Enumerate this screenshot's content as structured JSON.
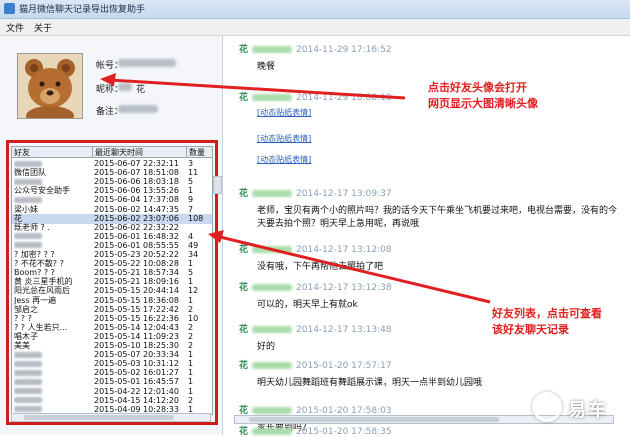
{
  "window": {
    "title": "猫月微信聊天记录导出恢复助手"
  },
  "menu": [
    {
      "label": "文件"
    },
    {
      "label": "关于"
    }
  ],
  "profile": {
    "account_label": "帐号：",
    "nickname_label": "昵称：",
    "nickname_value": "花",
    "remark_label": "备注："
  },
  "friends_table": {
    "columns": [
      "好友",
      "最近聊天时间",
      "数量"
    ],
    "rows": [
      {
        "name": "",
        "time": "2015-06-07 22:32:11",
        "count": "3"
      },
      {
        "name": "微信团队",
        "time": "2015-06-07 18:51:08",
        "count": "11"
      },
      {
        "name": "",
        "time": "2015-06-06 18:03:18",
        "count": "5"
      },
      {
        "name": "公众号安全助手",
        "time": "2015-06-06 13:55:26",
        "count": "1"
      },
      {
        "name": "",
        "time": "2015-06-04 17:37:08",
        "count": "9"
      },
      {
        "name": "梁小妹",
        "time": "2015-06-02 14:47:35",
        "count": "7"
      },
      {
        "name": "花",
        "time": "2015-06-02 23:07:06",
        "count": "108"
      },
      {
        "name": "既老师 ? . ",
        "time": "2015-06-02 22:32:22",
        "count": ""
      },
      {
        "name": "",
        "time": "2015-06-01 16:48:32",
        "count": "4"
      },
      {
        "name": "",
        "time": "2015-06-01 08:55:55",
        "count": "49"
      },
      {
        "name": "? 加密? ? ?",
        "time": "2015-05-23 20:52:22",
        "count": "34"
      },
      {
        "name": "? 不花不散? ?",
        "time": "2015-05-22 10:08:28",
        "count": "1"
      },
      {
        "name": "Boom? ? ?",
        "time": "2015-05-21 18:57:34",
        "count": "5"
      },
      {
        "name": "黄 炎三星手机的",
        "time": "2015-05-21 18:09:16",
        "count": "1"
      },
      {
        "name": "阳光总在风雨后",
        "time": "2015-05-15 20:44:14",
        "count": "12"
      },
      {
        "name": "Jess 再一遍",
        "time": "2015-05-15 18:36:08",
        "count": "1"
      },
      {
        "name": "邹启之",
        "time": "2015-05-15 17:22:42",
        "count": "2"
      },
      {
        "name": "? ? ?",
        "time": "2015-05-15 16:22:36",
        "count": "10"
      },
      {
        "name": "? ? 人生若只...",
        "time": "2015-05-14 12:04:43",
        "count": "2"
      },
      {
        "name": "唱木子",
        "time": "2015-05-14 11:09:23",
        "count": "2"
      },
      {
        "name": "美美",
        "time": "2015-05-10 18:25:30",
        "count": "2"
      },
      {
        "name": "",
        "time": "2015-05-07 20:33:34",
        "count": "1"
      },
      {
        "name": "",
        "time": "2015-05-03 10:31:12",
        "count": "1"
      },
      {
        "name": "",
        "time": "2015-05-02 16:01:27",
        "count": "1"
      },
      {
        "name": "",
        "time": "2015-05-01 16:45:57",
        "count": "1"
      },
      {
        "name": "",
        "time": "2015-04-22 12:01:40",
        "count": "1"
      },
      {
        "name": "",
        "time": "2015-04-15 14:12:20",
        "count": "2"
      },
      {
        "name": "",
        "time": "2015-04-09 10:28:33",
        "count": "1"
      }
    ]
  },
  "chat": [
    {
      "sender": "花",
      "timestamp": "2014-11-29 17:16:52",
      "text": "晚餐"
    },
    {
      "sender": "花",
      "timestamp": "2014-11-29 18:08:18",
      "link": "[动态贴纸表情]"
    },
    {
      "sender": "",
      "timestamp": "",
      "link": "[动态贴纸表情]"
    },
    {
      "sender": "",
      "timestamp": "",
      "link": "[动态贴纸表情]"
    },
    {
      "sender": "花",
      "timestamp": "2014-12-17 13:09:37",
      "text": "老师，宝贝有两个小的照片吗？我的话今天下午乘坐飞机要过来吧，电视台需要，没有的今",
      "text2": "天要去拍个照？明天早上急用呢，再说哦"
    },
    {
      "sender": "花",
      "timestamp": "2014-12-17 13:12:08",
      "text": "没有哦，下午再帮他去照拍了吧"
    },
    {
      "sender": "花",
      "timestamp": "2014-12-17 13:12:38",
      "text": "可以的，明天早上有就ok"
    },
    {
      "sender": "花",
      "timestamp": "2014-12-17 13:13:48",
      "text": "好的"
    },
    {
      "sender": "花",
      "timestamp": "2015-01-20 17:57:17",
      "text": "明天幼儿园舞蹈班有舞蹈展示课，明天一点半到幼儿园哦"
    },
    {
      "sender": "花",
      "timestamp": "2015-01-20 17:58:03",
      "text": "家长要到吗？"
    },
    {
      "sender": "花",
      "timestamp": "2015-01-20 17:58:35",
      "text": ""
    }
  ],
  "annotations": {
    "avatar_note_line1": "点击好友头像会打开",
    "avatar_note_line2": "网页显示大图清晰头像",
    "list_note_line1": "好友列表，点击可查看",
    "list_note_line2": "该好友聊天记录"
  },
  "watermark": {
    "text": "易车"
  },
  "colors": {
    "annotation": "#e02020",
    "sender": "#2e8b57",
    "link": "#2b5fbf"
  }
}
